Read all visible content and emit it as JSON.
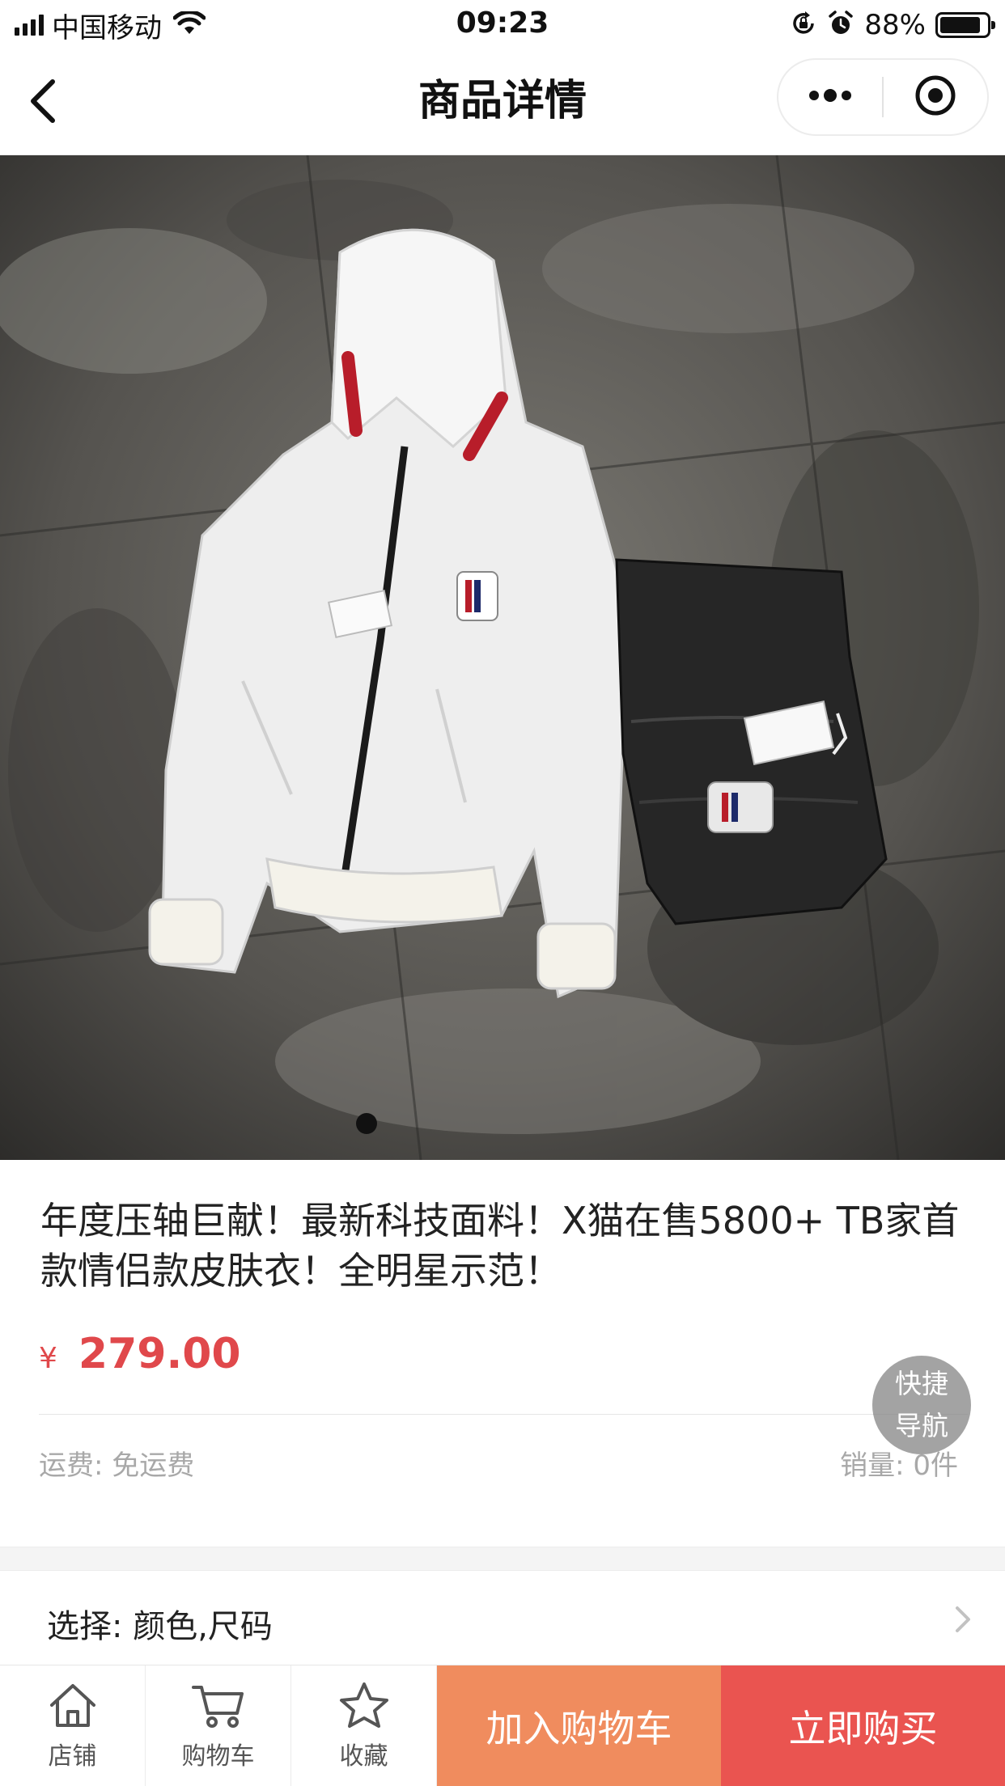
{
  "status_bar": {
    "carrier": "中国移动",
    "time": "09:23",
    "battery_percent": "88%",
    "battery_level": 0.88,
    "icons": [
      "signal-icon",
      "wifi-icon",
      "rotation-lock-icon",
      "alarm-icon",
      "battery-icon"
    ]
  },
  "nav": {
    "title": "商品详情",
    "icons": [
      "back-arrow-icon",
      "more-dots-icon",
      "close-target-icon"
    ]
  },
  "product": {
    "title": " 年度压轴巨献！最新科技面料！X猫在售5800+ TB家首款情侣款皮肤衣！全明星示范！",
    "currency": "¥",
    "price": "279.00",
    "shipping": "运费: 免运费",
    "sales": "销量: 0件"
  },
  "quick_nav": {
    "line1": "快捷",
    "line2": "导航"
  },
  "spec": {
    "label": "选择: 颜色,尺码"
  },
  "bottom_bar": {
    "tabs": [
      {
        "label": "店铺",
        "icon": "home-icon"
      },
      {
        "label": "购物车",
        "icon": "cart-icon"
      },
      {
        "label": "收藏",
        "icon": "star-icon"
      }
    ],
    "add_to_cart": "加入购物车",
    "buy_now": "立即购买"
  },
  "colors": {
    "price": "#e0484b",
    "add_to_cart_bg": "#f08c5e",
    "buy_now_bg": "#ea5450"
  }
}
